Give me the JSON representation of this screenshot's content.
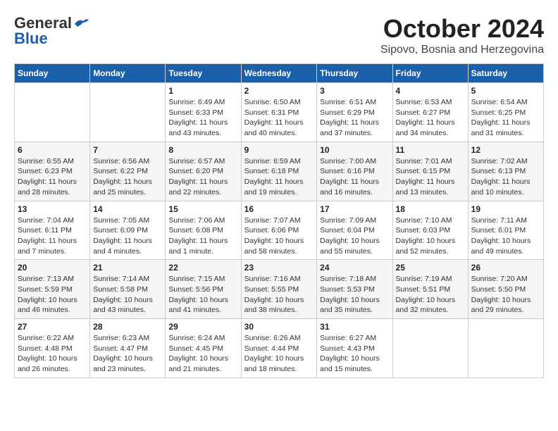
{
  "header": {
    "logo_general": "General",
    "logo_blue": "Blue",
    "month_year": "October 2024",
    "location": "Sipovo, Bosnia and Herzegovina"
  },
  "weekdays": [
    "Sunday",
    "Monday",
    "Tuesday",
    "Wednesday",
    "Thursday",
    "Friday",
    "Saturday"
  ],
  "weeks": [
    [
      {
        "day": "",
        "sunrise": "",
        "sunset": "",
        "daylight": ""
      },
      {
        "day": "",
        "sunrise": "",
        "sunset": "",
        "daylight": ""
      },
      {
        "day": "1",
        "sunrise": "Sunrise: 6:49 AM",
        "sunset": "Sunset: 6:33 PM",
        "daylight": "Daylight: 11 hours and 43 minutes."
      },
      {
        "day": "2",
        "sunrise": "Sunrise: 6:50 AM",
        "sunset": "Sunset: 6:31 PM",
        "daylight": "Daylight: 11 hours and 40 minutes."
      },
      {
        "day": "3",
        "sunrise": "Sunrise: 6:51 AM",
        "sunset": "Sunset: 6:29 PM",
        "daylight": "Daylight: 11 hours and 37 minutes."
      },
      {
        "day": "4",
        "sunrise": "Sunrise: 6:53 AM",
        "sunset": "Sunset: 6:27 PM",
        "daylight": "Daylight: 11 hours and 34 minutes."
      },
      {
        "day": "5",
        "sunrise": "Sunrise: 6:54 AM",
        "sunset": "Sunset: 6:25 PM",
        "daylight": "Daylight: 11 hours and 31 minutes."
      }
    ],
    [
      {
        "day": "6",
        "sunrise": "Sunrise: 6:55 AM",
        "sunset": "Sunset: 6:23 PM",
        "daylight": "Daylight: 11 hours and 28 minutes."
      },
      {
        "day": "7",
        "sunrise": "Sunrise: 6:56 AM",
        "sunset": "Sunset: 6:22 PM",
        "daylight": "Daylight: 11 hours and 25 minutes."
      },
      {
        "day": "8",
        "sunrise": "Sunrise: 6:57 AM",
        "sunset": "Sunset: 6:20 PM",
        "daylight": "Daylight: 11 hours and 22 minutes."
      },
      {
        "day": "9",
        "sunrise": "Sunrise: 6:59 AM",
        "sunset": "Sunset: 6:18 PM",
        "daylight": "Daylight: 11 hours and 19 minutes."
      },
      {
        "day": "10",
        "sunrise": "Sunrise: 7:00 AM",
        "sunset": "Sunset: 6:16 PM",
        "daylight": "Daylight: 11 hours and 16 minutes."
      },
      {
        "day": "11",
        "sunrise": "Sunrise: 7:01 AM",
        "sunset": "Sunset: 6:15 PM",
        "daylight": "Daylight: 11 hours and 13 minutes."
      },
      {
        "day": "12",
        "sunrise": "Sunrise: 7:02 AM",
        "sunset": "Sunset: 6:13 PM",
        "daylight": "Daylight: 11 hours and 10 minutes."
      }
    ],
    [
      {
        "day": "13",
        "sunrise": "Sunrise: 7:04 AM",
        "sunset": "Sunset: 6:11 PM",
        "daylight": "Daylight: 11 hours and 7 minutes."
      },
      {
        "day": "14",
        "sunrise": "Sunrise: 7:05 AM",
        "sunset": "Sunset: 6:09 PM",
        "daylight": "Daylight: 11 hours and 4 minutes."
      },
      {
        "day": "15",
        "sunrise": "Sunrise: 7:06 AM",
        "sunset": "Sunset: 6:08 PM",
        "daylight": "Daylight: 11 hours and 1 minute."
      },
      {
        "day": "16",
        "sunrise": "Sunrise: 7:07 AM",
        "sunset": "Sunset: 6:06 PM",
        "daylight": "Daylight: 10 hours and 58 minutes."
      },
      {
        "day": "17",
        "sunrise": "Sunrise: 7:09 AM",
        "sunset": "Sunset: 6:04 PM",
        "daylight": "Daylight: 10 hours and 55 minutes."
      },
      {
        "day": "18",
        "sunrise": "Sunrise: 7:10 AM",
        "sunset": "Sunset: 6:03 PM",
        "daylight": "Daylight: 10 hours and 52 minutes."
      },
      {
        "day": "19",
        "sunrise": "Sunrise: 7:11 AM",
        "sunset": "Sunset: 6:01 PM",
        "daylight": "Daylight: 10 hours and 49 minutes."
      }
    ],
    [
      {
        "day": "20",
        "sunrise": "Sunrise: 7:13 AM",
        "sunset": "Sunset: 5:59 PM",
        "daylight": "Daylight: 10 hours and 46 minutes."
      },
      {
        "day": "21",
        "sunrise": "Sunrise: 7:14 AM",
        "sunset": "Sunset: 5:58 PM",
        "daylight": "Daylight: 10 hours and 43 minutes."
      },
      {
        "day": "22",
        "sunrise": "Sunrise: 7:15 AM",
        "sunset": "Sunset: 5:56 PM",
        "daylight": "Daylight: 10 hours and 41 minutes."
      },
      {
        "day": "23",
        "sunrise": "Sunrise: 7:16 AM",
        "sunset": "Sunset: 5:55 PM",
        "daylight": "Daylight: 10 hours and 38 minutes."
      },
      {
        "day": "24",
        "sunrise": "Sunrise: 7:18 AM",
        "sunset": "Sunset: 5:53 PM",
        "daylight": "Daylight: 10 hours and 35 minutes."
      },
      {
        "day": "25",
        "sunrise": "Sunrise: 7:19 AM",
        "sunset": "Sunset: 5:51 PM",
        "daylight": "Daylight: 10 hours and 32 minutes."
      },
      {
        "day": "26",
        "sunrise": "Sunrise: 7:20 AM",
        "sunset": "Sunset: 5:50 PM",
        "daylight": "Daylight: 10 hours and 29 minutes."
      }
    ],
    [
      {
        "day": "27",
        "sunrise": "Sunrise: 6:22 AM",
        "sunset": "Sunset: 4:48 PM",
        "daylight": "Daylight: 10 hours and 26 minutes."
      },
      {
        "day": "28",
        "sunrise": "Sunrise: 6:23 AM",
        "sunset": "Sunset: 4:47 PM",
        "daylight": "Daylight: 10 hours and 23 minutes."
      },
      {
        "day": "29",
        "sunrise": "Sunrise: 6:24 AM",
        "sunset": "Sunset: 4:45 PM",
        "daylight": "Daylight: 10 hours and 21 minutes."
      },
      {
        "day": "30",
        "sunrise": "Sunrise: 6:26 AM",
        "sunset": "Sunset: 4:44 PM",
        "daylight": "Daylight: 10 hours and 18 minutes."
      },
      {
        "day": "31",
        "sunrise": "Sunrise: 6:27 AM",
        "sunset": "Sunset: 4:43 PM",
        "daylight": "Daylight: 10 hours and 15 minutes."
      },
      {
        "day": "",
        "sunrise": "",
        "sunset": "",
        "daylight": ""
      },
      {
        "day": "",
        "sunrise": "",
        "sunset": "",
        "daylight": ""
      }
    ]
  ]
}
